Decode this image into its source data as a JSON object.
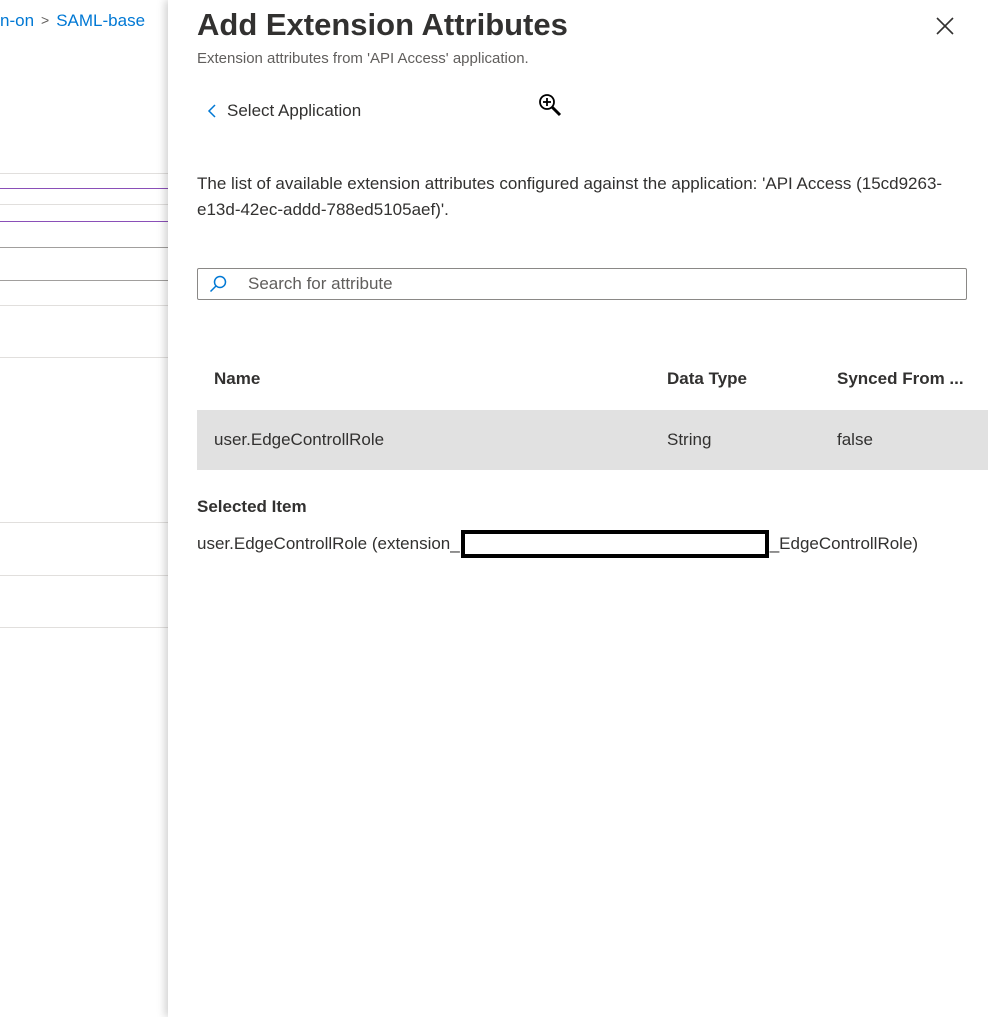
{
  "background": {
    "breadcrumb": [
      {
        "label": "n-on"
      },
      {
        "label": "SAML-base"
      }
    ],
    "breadcrumb_separator": ">"
  },
  "panel": {
    "title": "Add Extension Attributes",
    "subtitle": "Extension attributes from 'API Access' application.",
    "close_icon": "close-icon",
    "back_link_label": "Select Application",
    "description": "The list of available extension attributes configured against the application: 'API Access (15cd9263-e13d-42ec-addd-788ed5105aef)'.",
    "search": {
      "placeholder": "Search for attribute",
      "value": ""
    },
    "table": {
      "columns": [
        "Name",
        "Data Type",
        "Synced From ..."
      ],
      "rows": [
        {
          "name": "user.EdgeControllRole",
          "data_type": "String",
          "synced_from": "false"
        }
      ]
    },
    "selected_item": {
      "label": "Selected Item",
      "value_prefix": "user.EdgeControllRole (extension_",
      "value_suffix": "_EdgeControllRole)"
    }
  },
  "colors": {
    "accent": "#0078d4",
    "row_selected_bg": "#e1e1e1",
    "bg_line_purple": "#8a4fb8"
  }
}
